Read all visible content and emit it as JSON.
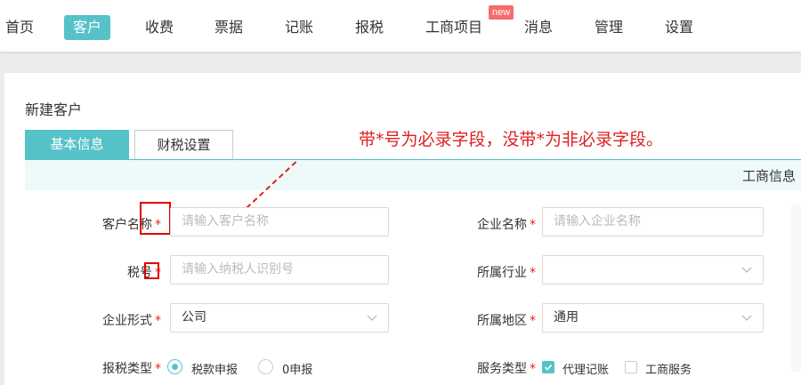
{
  "nav": {
    "items": [
      "首页",
      "客户",
      "收费",
      "票据",
      "记账",
      "报税",
      "工商项目",
      "消息",
      "管理",
      "设置"
    ],
    "active": "客户",
    "badge": "new"
  },
  "page": {
    "title": "新建客户",
    "tabs": [
      "基本信息",
      "财税设置"
    ],
    "section_title": "工商信息",
    "annotation": "带*号为必录字段，没带*为非必录字段。"
  },
  "form": {
    "required_mark": "*",
    "customer_name": {
      "label": "客户名称",
      "placeholder": "请输入客户名称"
    },
    "company_name": {
      "label": "企业名称",
      "placeholder": "请输入企业名称"
    },
    "tax_id": {
      "label": "税号",
      "placeholder": "请输入纳税人识别号"
    },
    "industry": {
      "label": "所属行业",
      "value": ""
    },
    "company_form": {
      "label": "企业形式",
      "value": "公司"
    },
    "region": {
      "label": "所属地区",
      "value": "通用"
    },
    "tax_type": {
      "label": "报税类型",
      "options": [
        "税款申报",
        "0申报"
      ],
      "selected": "税款申报"
    },
    "service_type": {
      "label": "服务类型",
      "options": [
        "代理记账",
        "工商服务"
      ],
      "checked": [
        "代理记账"
      ]
    }
  },
  "colors": {
    "accent": "#55c2c8",
    "required": "#e02020",
    "badge": "#f56c6c"
  }
}
